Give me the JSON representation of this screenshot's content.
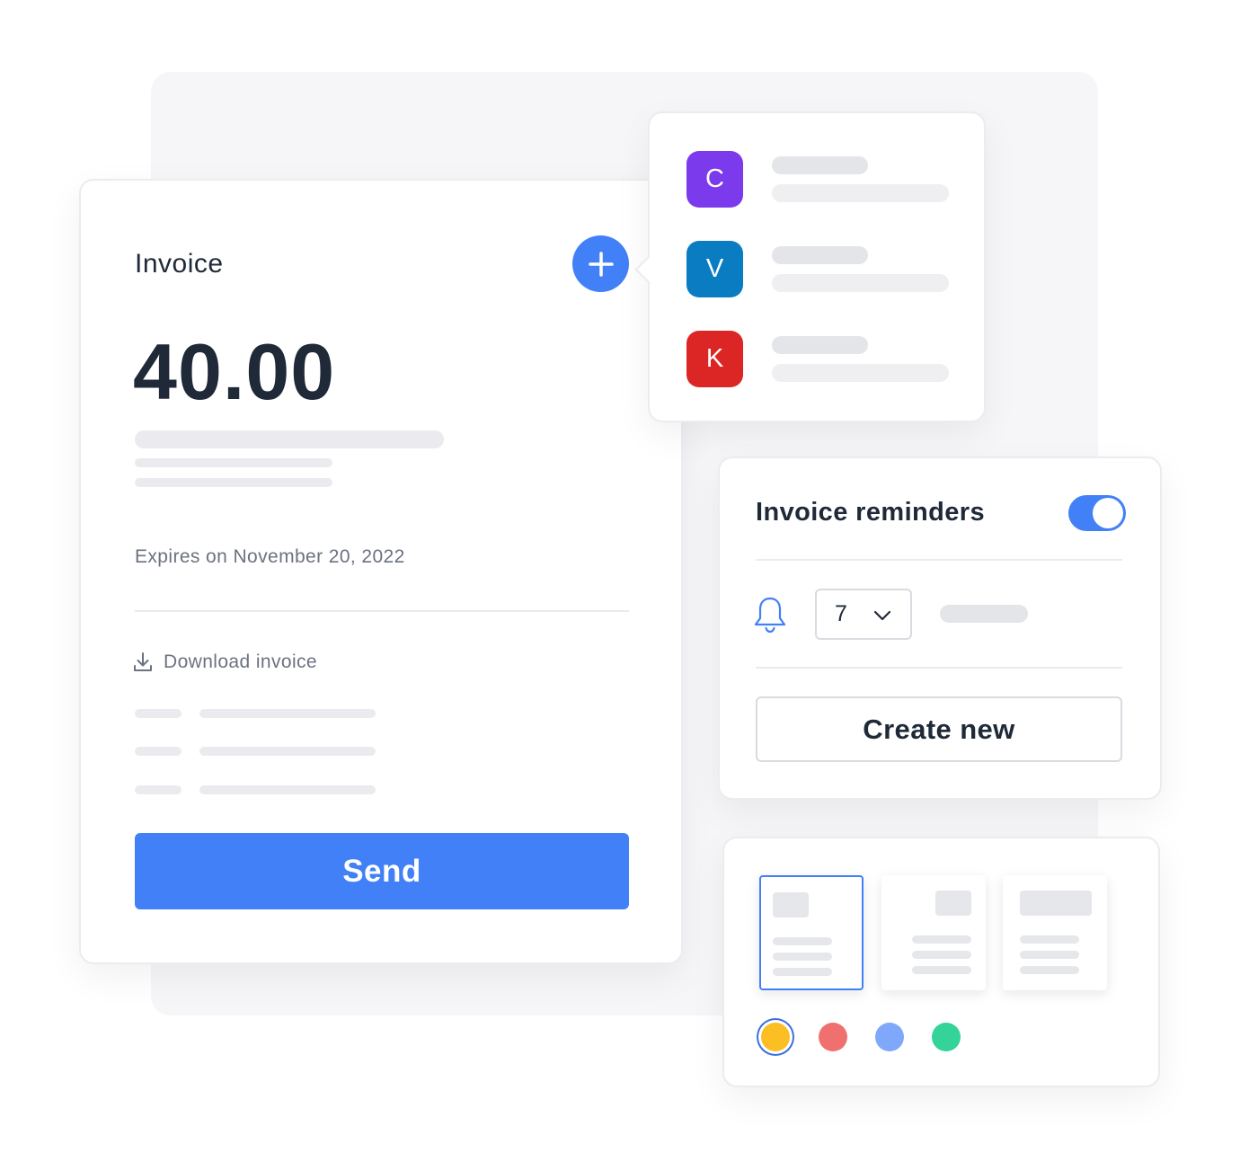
{
  "invoice": {
    "title": "Invoice",
    "amount": "40.00",
    "expires_text": "Expires on November 20, 2022",
    "download_label": "Download invoice",
    "send_label": "Send",
    "add_icon": "plus-icon",
    "download_icon": "download-icon"
  },
  "clients": {
    "items": [
      {
        "initial": "C",
        "color": "#7c3aed"
      },
      {
        "initial": "V",
        "color": "#0a7dc2"
      },
      {
        "initial": "K",
        "color": "#dc2626"
      }
    ]
  },
  "reminders": {
    "title": "Invoice reminders",
    "enabled": true,
    "bell_icon": "bell-icon",
    "days_value": "7",
    "create_new_label": "Create new"
  },
  "templates": {
    "selected_index": 0,
    "count": 3
  },
  "colors": {
    "accent": "#4280f7",
    "swatches": [
      "#fbbf24",
      "#f07070",
      "#80a8fa",
      "#34d399"
    ],
    "selected_swatch_index": 0
  }
}
